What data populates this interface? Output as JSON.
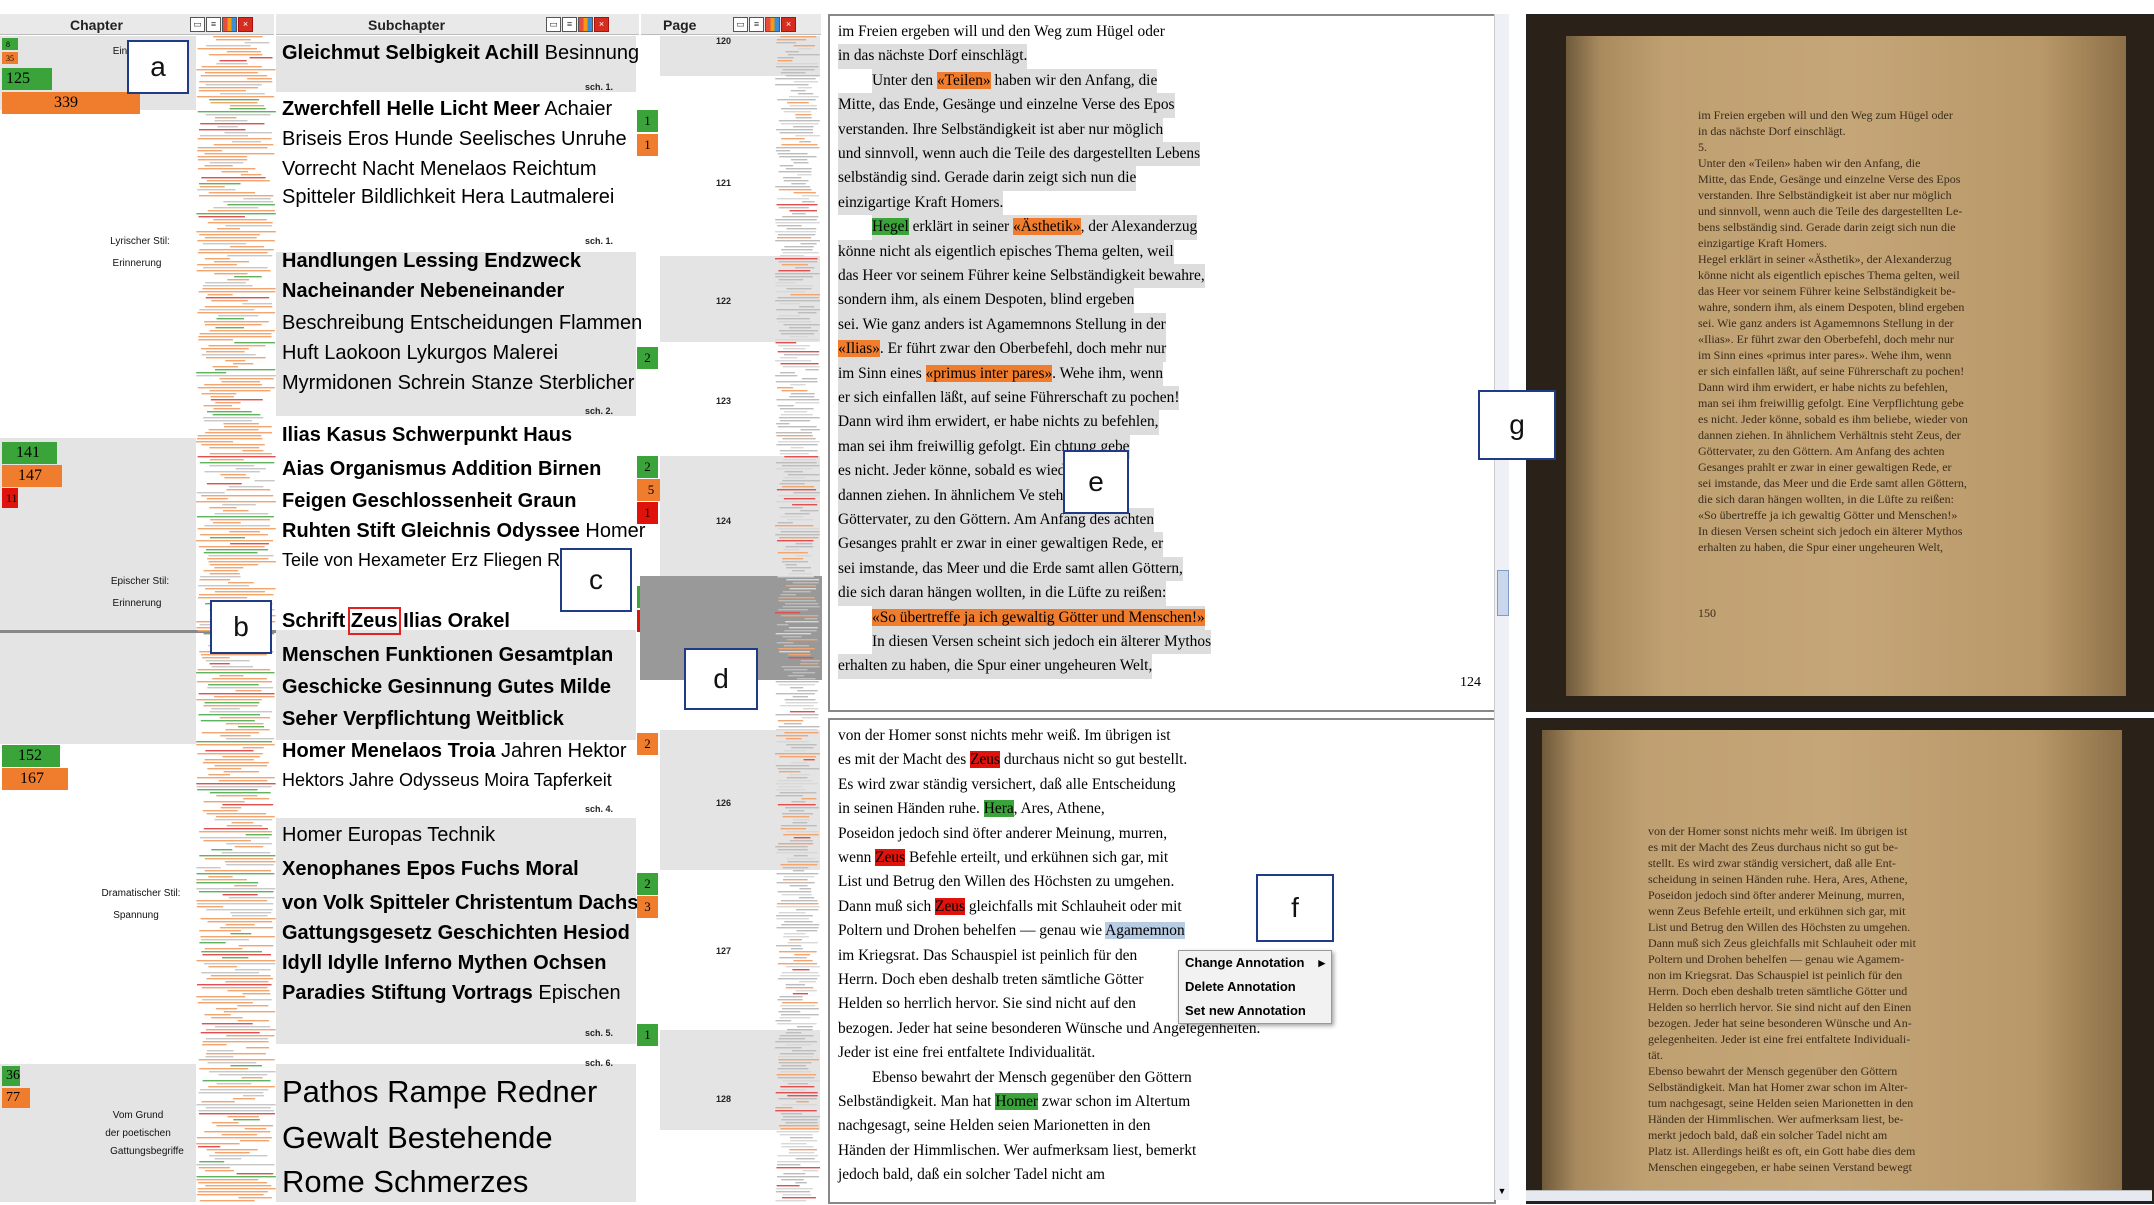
{
  "chapter_header": "Chapter",
  "subchapter_header": "Subchapter",
  "page_header": "Page",
  "chapter_counts": [
    "8",
    "35",
    "125",
    "339",
    "141",
    "147",
    "11",
    "152",
    "167",
    "36",
    "77"
  ],
  "chapter_labels": {
    "c0": "Ein",
    "c1": "Lyrischer Stil:",
    "c1b": "Erinnerung",
    "c2": "Epischer Stil:",
    "c2b": "Erinnerung",
    "c3": "Dramatischer Stil:",
    "c3b": "Spannung",
    "c4": "Vom Grund",
    "c4b": "der poetischen",
    "c4c": "Gattungsbegriffe"
  },
  "subchapter_words": [
    {
      "b": "Gleichmut Selbigkeit Achill",
      "n": " Besinnung"
    },
    {
      "b": "Zwerchfell Helle Licht Meer",
      "n": " Achaier"
    },
    {
      "b": "",
      "n": "Briseis Eros Hunde Seelisches Unruhe"
    },
    {
      "b": "",
      "n": "Vorrecht Nacht Menelaos Reichtum"
    },
    {
      "b": "",
      "n": "Spitteler Bildlichkeit Hera Lautmalerei"
    },
    {
      "b": "Handlungen Lessing Endzweck",
      "n": ""
    },
    {
      "b": "Nacheinander Nebeneinander",
      "n": ""
    },
    {
      "b": "",
      "n": "Beschreibung Entscheidungen Flammen"
    },
    {
      "b": "",
      "n": "Huft Laokoon Lykurgos Malerei"
    },
    {
      "b": "",
      "n": "Myrmidonen Schrein Stanze Sterblicher"
    },
    {
      "b": "Ilias Kasus Schwerpunkt Haus",
      "n": ""
    },
    {
      "b": "Aias Organismus Addition Birnen",
      "n": ""
    },
    {
      "b": "Feigen Geschlossenheit Graun",
      "n": ""
    },
    {
      "b": "Ruhten Stift Gleichnis Odyssee",
      "n": " Homer"
    },
    {
      "b": "",
      "n": "Teile von Hexameter Erz Fliegen R"
    },
    {
      "b": "Menschen Funktionen Gesamtplan",
      "n": ""
    },
    {
      "b": "Geschicke Gesinnung Gutes Milde",
      "n": ""
    },
    {
      "b": "Seher Verpflichtung Weitblick",
      "n": ""
    },
    {
      "b": "Homer Menelaos Troia",
      "n": " Jahren Hektor"
    },
    {
      "b": "",
      "n": "Hektors Jahre Odysseus Moira Tapferkeit"
    },
    {
      "b": "",
      "n": "Homer Europas Technik"
    },
    {
      "b": "Xenophanes Epos Fuchs Moral",
      "n": ""
    },
    {
      "b": "von Volk Spitteler Christentum Dachs",
      "n": ""
    },
    {
      "b": "Gattungsgesetz Geschichten Hesiod",
      "n": ""
    },
    {
      "b": "Idyll Idylle Inferno Mythen Ochsen",
      "n": ""
    },
    {
      "b": "Paradies Stiftung Vortrags",
      "n": " Epischen"
    },
    {
      "b": "",
      "n": "Pathos Rampe Redner"
    },
    {
      "b": "",
      "n": "Gewalt Bestehende"
    },
    {
      "b": "",
      "n": "Rome Schmerzes"
    }
  ],
  "zeus_line": {
    "a": "Schrift ",
    "z": "Zeus",
    "c": " Ilias Orakel"
  },
  "pathos_line": {
    "a": "Pathos",
    "c": " Rampe Redner"
  },
  "sch_labels": [
    "sch. 1.",
    "sch. 1.",
    "sch. 2.",
    "sch. 4.",
    "sch. 5.",
    "sch. 6."
  ],
  "page_numbers": [
    "120",
    "121",
    "122",
    "123",
    "124",
    "126",
    "127",
    "128"
  ],
  "mini_counts": [
    "1",
    "1",
    "2",
    "2",
    "5",
    "1",
    "3",
    "4",
    "2",
    "2",
    "3",
    "1"
  ],
  "labels": {
    "a": "a",
    "b": "b",
    "c": "c",
    "d": "d",
    "e": "e",
    "f": "f",
    "g": "g"
  },
  "reader_top": {
    "lines": [
      "im Freien ergeben will und den Weg zum Hügel oder",
      "in das nächste Dorf einschlägt.",
      "Unter den «Teilen» haben wir den Anfang, die",
      "Mitte, das Ende, Gesänge und einzelne Verse des Epos",
      "verstanden. Ihre Selbständigkeit ist aber nur möglich",
      "und sinnvoll, wenn auch die Teile des dargestellten Lebens",
      "selbständig sind. Gerade darin zeigt sich nun die",
      "einzigartige Kraft Homers.",
      "Hegel erklärt in seiner «Ästhetik», der Alexanderzug",
      "könne nicht als eigentlich episches Thema gelten, weil",
      "das Heer vor seinem Führer keine Selbständigkeit bewahre,",
      "sondern ihm, als einem Despoten, blind ergeben",
      "sei. Wie ganz anders ist Agamemnons Stellung in der",
      "«Ilias». Er führt zwar den Oberbefehl, doch mehr nur",
      "im Sinn eines «primus inter pares». Wehe ihm, wenn",
      "er sich einfallen läßt, auf seine Führerschaft zu pochen!",
      "Dann wird ihm erwidert, er habe nichts zu befehlen,",
      "man sei ihm freiwillig gefolgt. Ein          chtung gebe",
      "es nicht. Jeder könne, sobald es              wieder von",
      "dannen ziehen. In ähnlichem Ve            steht Zeus, der",
      "Göttervater, zu den Göttern. Am Anfang des achten",
      "Gesanges prahlt er zwar in einer gewaltigen Rede, er",
      "sei imstande, das Meer und die Erde samt allen Göttern,",
      "die sich daran hängen wollten, in die Lüfte zu reißen:",
      "«So übertreffe ja ich gewaltig Götter und Menschen!»",
      "In diesen Versen scheint sich jedoch ein älterer Mythos",
      "erhalten zu haben, die Spur einer ungeheuren Welt,"
    ],
    "page_number": "124"
  },
  "reader_bottom": {
    "lines": [
      "von der Homer sonst nichts mehr weiß. Im übrigen ist",
      "es mit der Macht des Zeus durchaus nicht so gut bestellt.",
      "Es wird zwar ständig versichert, daß alle Entscheidung",
      "in seinen Händen ruhe. Hera, Ares, Athene,",
      "Poseidon jedoch sind öfter anderer Meinung, murren,",
      "wenn Zeus Befehle erteilt, und erkühnen sich gar, mit",
      "List und Betrug den Willen des Höchsten zu umgehen.",
      "Dann muß sich Zeus gleichfalls mit Schlauheit oder mit",
      "Poltern und Drohen behelfen — genau wie Agamemnon",
      "im Kriegsrat. Das Schauspiel ist peinlich für den",
      "Herrn. Doch eben deshalb treten sämtliche Götter",
      "Helden so herrlich hervor. Sie sind nicht auf den",
      "bezogen. Jeder hat seine besonderen Wünsche und Angelegenheiten.",
      "Jeder ist eine frei entfaltete Individualität.",
      "Ebenso bewahrt der Mensch gegenüber den Göttern",
      "Selbständigkeit. Man hat Homer zwar schon im Altertum",
      "nachgesagt, seine Helden seien Marionetten in den",
      "Händen der Himmlischen. Wer aufmerksam liest, bemerkt",
      "jedoch bald, daß ein solcher Tadel nicht am"
    ]
  },
  "context_menu": [
    "Change Annotation",
    "Delete Annotation",
    "Set new Annotation"
  ],
  "scan_top": {
    "lines": [
      "im Freien ergeben will und den Weg zum Hügel oder",
      "in das nächste Dorf einschlägt.",
      "5.",
      "Unter den «Teilen» haben wir den Anfang, die",
      "Mitte, das Ende, Gesänge und einzelne Verse des Epos",
      "verstanden. Ihre Selbständigkeit ist aber nur möglich",
      "und sinnvoll, wenn auch die Teile des dargestellten Le-",
      "bens selbständig sind. Gerade darin zeigt sich nun die",
      "einzigartige Kraft Homers.",
      "Hegel erklärt in seiner «Ästhetik», der Alexanderzug",
      "könne nicht als eigentlich episches Thema gelten, weil",
      "das Heer vor seinem Führer keine Selbständigkeit be-",
      "wahre, sondern ihm, als einem Despoten, blind ergeben",
      "sei. Wie ganz anders ist Agamemnons Stellung in der",
      "«Ilias». Er führt zwar den Oberbefehl, doch mehr nur",
      "im Sinn eines «primus inter pares». Wehe ihm, wenn",
      "er sich einfallen läßt, auf seine Führerschaft zu pochen!",
      "Dann wird ihm erwidert, er habe nichts zu befehlen,",
      "man sei ihm freiwillig gefolgt. Eine Verpflichtung gebe",
      "es nicht. Jeder könne, sobald es ihm beliebe, wieder von",
      "dannen ziehen. In ähnlichem Verhältnis steht Zeus, der",
      "Göttervater, zu den Göttern. Am Anfang des achten",
      "Gesanges prahlt er zwar in einer gewaltigen Rede, er",
      "sei imstande, das Meer und die Erde samt allen Göttern,",
      "die sich daran hängen wollten, in die Lüfte zu reißen:",
      "«So übertreffe ja ich gewaltig Götter und Menschen!»",
      "In diesen Versen scheint sich jedoch ein älterer Mythos",
      "erhalten zu haben, die Spur einer ungeheuren Welt,"
    ],
    "page_number": "150"
  },
  "scan_bottom": {
    "lines": [
      "von der Homer sonst nichts mehr weiß. Im übrigen ist",
      "es mit der Macht des Zeus durchaus nicht so gut be-",
      "stellt. Es wird zwar ständig versichert, daß alle Ent-",
      "scheidung in seinen Händen ruhe. Hera, Ares, Athene,",
      "Poseidon jedoch sind öfter anderer Meinung, murren,",
      "wenn Zeus Befehle erteilt, und erkühnen sich gar, mit",
      "List und Betrug den Willen des Höchsten zu umgehen.",
      "Dann muß sich Zeus gleichfalls mit Schlauheit oder mit",
      "Poltern und Drohen behelfen — genau wie Agamem-",
      "non im Kriegsrat. Das Schauspiel ist peinlich für den",
      "Herrn. Doch eben deshalb treten sämtliche Götter und",
      "Helden so herrlich hervor. Sie sind nicht auf den Einen",
      "bezogen. Jeder hat seine besonderen Wünsche und An-",
      "gelegenheiten. Jeder ist eine frei entfaltete Individuali-",
      "tät.",
      "Ebenso bewahrt der Mensch gegenüber den Göttern",
      "Selbständigkeit. Man hat Homer zwar schon im Alter-",
      "tum nachgesagt, seine Helden seien Marionetten in den",
      "Händen der Himmlischen. Wer aufmerksam liest, be-",
      "merkt jedoch bald, daß ein solcher Tadel nicht am",
      "Platz ist. Allerdings heißt es oft, ein Gott habe dies dem",
      "Menschen eingegeben, er habe seinen Verstand bewegt"
    ]
  },
  "colors": {
    "green": "#3aa33a",
    "orange": "#f07d2e",
    "red": "#e0120c",
    "band": "#e4e4e4",
    "selection": "#b8cde4"
  }
}
